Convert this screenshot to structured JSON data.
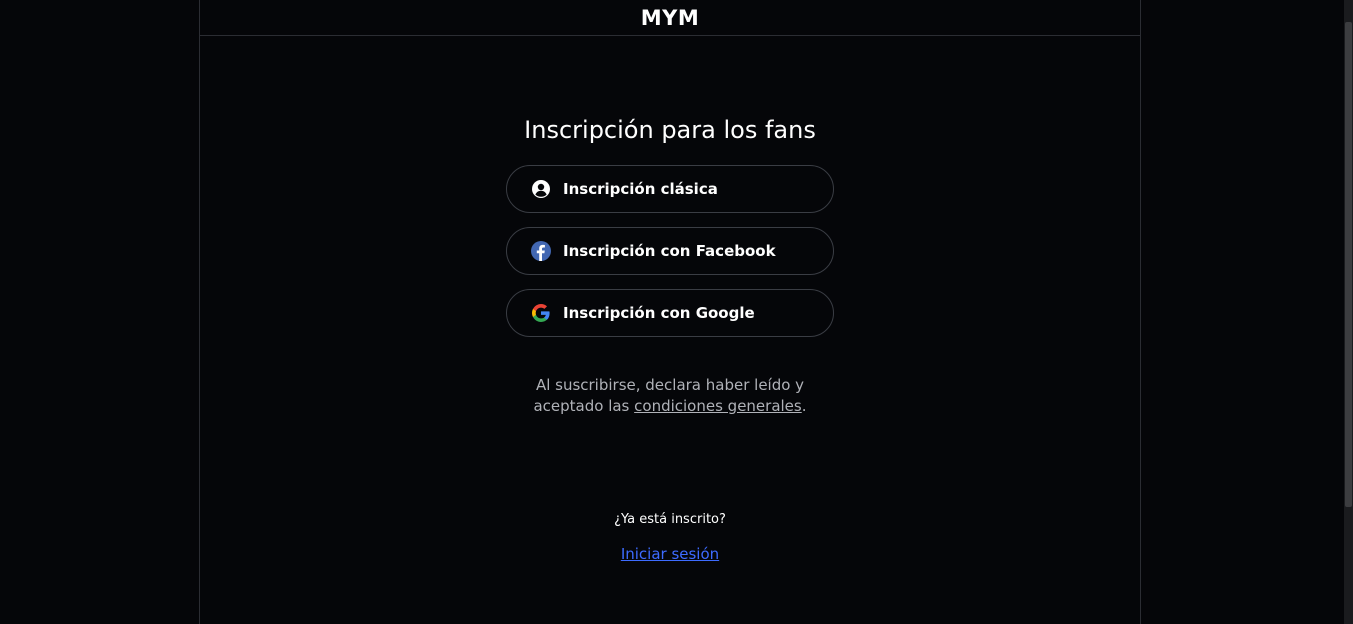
{
  "header": {
    "logo_text": "MYM"
  },
  "main": {
    "title": "Inscripción para los fans",
    "buttons": {
      "classic": {
        "label": "Inscripción clásica",
        "icon": "user-circle-icon"
      },
      "facebook": {
        "label": "Inscripción con Facebook",
        "icon": "facebook-icon"
      },
      "google": {
        "label": "Inscripción con Google",
        "icon": "google-icon"
      }
    },
    "terms": {
      "line1": "Al suscribirse, declara haber leído y",
      "line2_prefix": "aceptado las ",
      "link": "condiciones generales",
      "line2_suffix": "."
    },
    "already_registered": "¿Ya está inscrito?",
    "login_link": "Iniciar sesión"
  },
  "colors": {
    "background": "#050609",
    "border": "#2b2d33",
    "link_blue": "#3d6bff",
    "muted_text": "#b0b2b8",
    "facebook_blue": "#4267b2"
  }
}
